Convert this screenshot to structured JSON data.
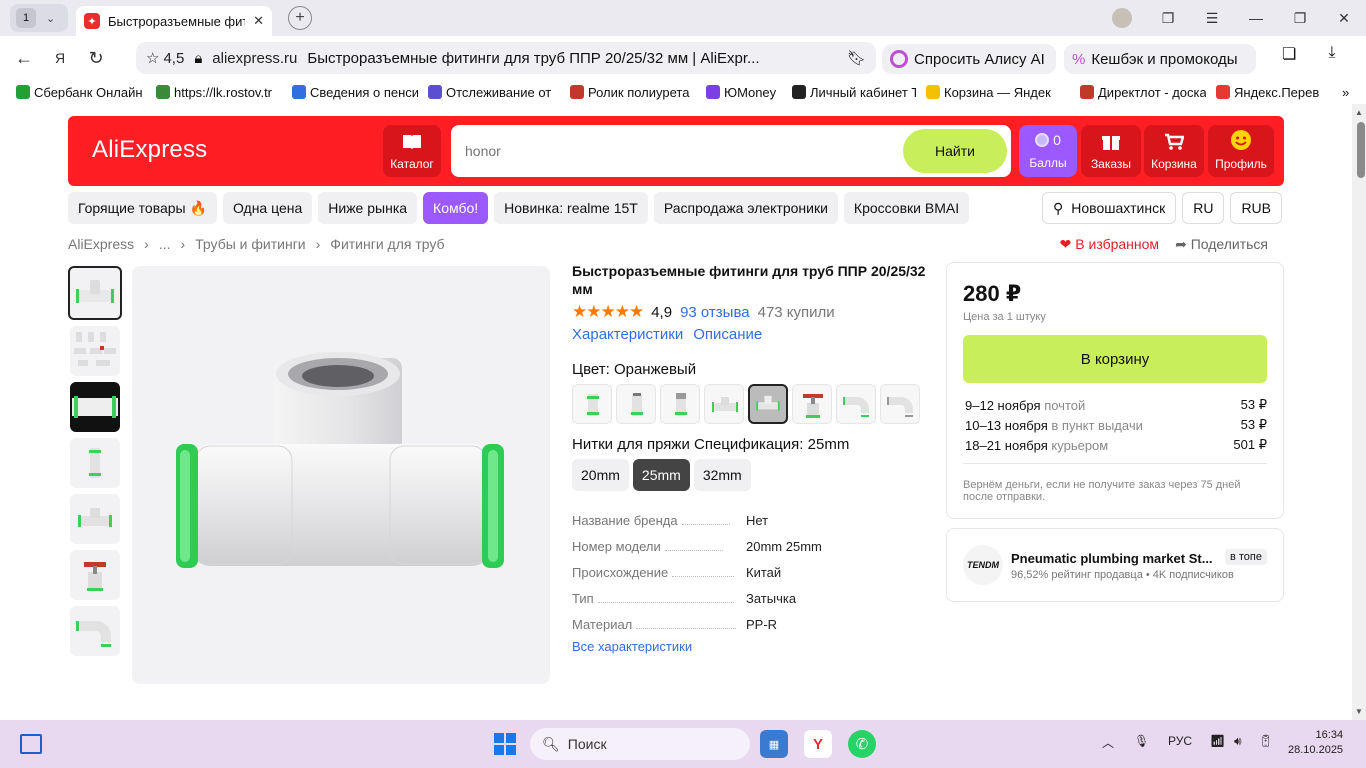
{
  "browser": {
    "tab_count": "1",
    "tab_title": "Быстроразъемные фит",
    "rating": "4,5",
    "domain": "aliexpress.ru",
    "page_title": "Быстроразъемные фитинги для труб ППР 20/25/32 мм | AliExpr...",
    "alisa": "Спросить Алису AI",
    "cashback": "Кешбэк и промокоды",
    "bookmarks": [
      {
        "label": "Сбербанк Онлайн",
        "color": "#21a038"
      },
      {
        "label": "https://lk.rostov.tr",
        "color": "#3a8a3a"
      },
      {
        "label": "Сведения о пенси",
        "color": "#2f6fe0"
      },
      {
        "label": "Отслеживание от",
        "color": "#5a4fd0"
      },
      {
        "label": "Ролик полиурета",
        "color": "#c0392b"
      },
      {
        "label": "ЮMoney",
        "color": "#7b3fe4"
      },
      {
        "label": "Личный кабинет Т",
        "color": "#222222"
      },
      {
        "label": "Корзина — Яндек",
        "color": "#f2c200"
      },
      {
        "label": "Директлот - доска",
        "color": "#c0392b"
      },
      {
        "label": "Яндекс.Перев",
        "color": "#e53935"
      }
    ]
  },
  "header": {
    "logo": "AliExpress",
    "catalog": "Каталог",
    "search_value": "honor",
    "find": "Найти",
    "points_count": "0",
    "points_label": "Баллы",
    "orders": "Заказы",
    "cart": "Корзина",
    "profile": "Профиль"
  },
  "chips": [
    "Горящие товары 🔥",
    "Одна цена",
    "Ниже рынка",
    "Комбо!",
    "Новинка: realme 15T",
    "Распродажа электроники",
    "Кроссовки BMAI"
  ],
  "location": {
    "city": "Новошахтинск",
    "lang": "RU",
    "currency": "RUB"
  },
  "breadcrumbs": [
    "AliExpress",
    "...",
    "Трубы и фитинги",
    "Фитинги для труб"
  ],
  "actions": {
    "favorite": "В избранном",
    "share": "Поделиться"
  },
  "product": {
    "title": "Быстроразъемные фитинги для труб ППР 20/25/32 мм",
    "rating": "4,9",
    "reviews": "93 отзыва",
    "bought": "473 купили",
    "tab_specs": "Характеристики",
    "tab_desc": "Описание",
    "color_label": "Цвет: Оранжевый",
    "size_label": "Нитки для пряжи Спецификация: 25mm",
    "sizes": [
      "20mm",
      "25mm",
      "32mm"
    ],
    "specs": [
      {
        "k": "Название бренда",
        "v": "Нет"
      },
      {
        "k": "Номер модели",
        "v": "20mm 25mm"
      },
      {
        "k": "Происхождение",
        "v": "Китай"
      },
      {
        "k": "Тип",
        "v": "Затычка"
      },
      {
        "k": "Материал",
        "v": "PP-R"
      }
    ],
    "all_specs": "Все характеристики"
  },
  "buy": {
    "price": "280 ₽",
    "per": "Цена за 1 штуку",
    "cart_btn": "В корзину",
    "delivery": [
      {
        "date": "9–12 ноября",
        "how": "почтой",
        "price": "53 ₽"
      },
      {
        "date": "10–13 ноября",
        "how": "в пункт выдачи",
        "price": "53 ₽"
      },
      {
        "date": "18–21 ноября",
        "how": "курьером",
        "price": "501 ₽"
      }
    ],
    "guarantee": "Вернём деньги, если не получите заказ через 75 дней после отправки."
  },
  "seller": {
    "logo_text": "TENDM",
    "name": "Pneumatic plumbing market St...",
    "meta": "96,52% рейтинг продавца • 4K подписчиков",
    "badge": "в топе"
  },
  "taskbar": {
    "search": "Поиск",
    "lang": "РУС",
    "time": "16:34",
    "date": "28.10.2025"
  },
  "colors": {
    "ali_red": "#ff1e24",
    "lime": "#c8ee5a",
    "purple": "#9b59ff",
    "link": "#2f6fe0"
  }
}
